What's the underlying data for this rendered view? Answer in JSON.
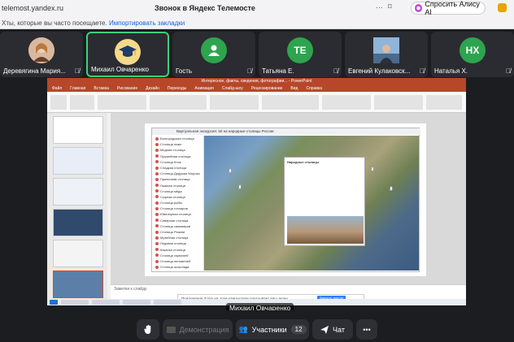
{
  "browser": {
    "url": "telemost.yandex.ru",
    "tab_title": "Звонок в Яндекс Телемосте",
    "alice_label": "Спросить Алису AI",
    "icons": [
      "more-icon",
      "bookmark-icon"
    ]
  },
  "bookmarks": {
    "text": "Хты, которые вы часто посещаете.",
    "link": "Импортировать закладки"
  },
  "participants": [
    {
      "name": "Деревягина Мария...",
      "avatar": "photo",
      "color": "#c98a6a",
      "active": false
    },
    {
      "name": "Михаил Овчаренко",
      "avatar": "graduation-cap",
      "color": "#f5d98a",
      "active": true
    },
    {
      "name": "Гость",
      "avatar": "person",
      "color": "#2ea44f",
      "active": false
    },
    {
      "name": "Татьяна Е.",
      "initials": "ТЕ",
      "color": "#2ea44f",
      "active": false
    },
    {
      "name": "Евгений Кулаковск...",
      "avatar": "photo",
      "color": "#7ea2c7",
      "active": false
    },
    {
      "name": "Наталья Х.",
      "initials": "НХ",
      "color": "#2ea44f",
      "active": false
    }
  ],
  "shared_screen": {
    "window_title": "Интересное, факты, сведения, фотографии... - PowerPoint",
    "ribbon_tabs": [
      "Файл",
      "Главная",
      "Вставка",
      "Рисование",
      "Дизайн",
      "Переходы",
      "Анимация",
      "Слайд-шоу",
      "Рецензирование",
      "Вид",
      "Справка"
    ],
    "map_header": "Виртуальная экскурсия: 50 на народные столицы России",
    "map_list": [
      "Белгородская столица",
      "Столица нижн",
      "Медная столица",
      "Оружейная столица",
      "Столица ёлок",
      "Сладкая столица",
      "Столица Дедушки Мороза",
      "Пряничная столица",
      "Лыжная столица",
      "Столица мёда",
      "Сырная столица",
      "Столица рыбы",
      "Столица гончаров",
      "Ювелирная столица",
      "Северная столица",
      "Столица самоваров",
      "Столица Рязани",
      "Музейная столица",
      "Ледовая столица",
      "Казачья столица",
      "Столица гармоней",
      "Столица пельменей",
      "Столица шоколада"
    ],
    "popup_title": "Народные столицы",
    "notes_placeholder": "Заметки к слайду",
    "notification": "Приложение Zoom на этом компьютере показывает ваш экран",
    "notification_button": "Закрыть доступ"
  },
  "speaker": "Михаил Овчаренко",
  "toolbar": {
    "demo_label": "Демонстрация",
    "participants_label": "Участники",
    "participants_count": "12",
    "chat_label": "Чат"
  }
}
